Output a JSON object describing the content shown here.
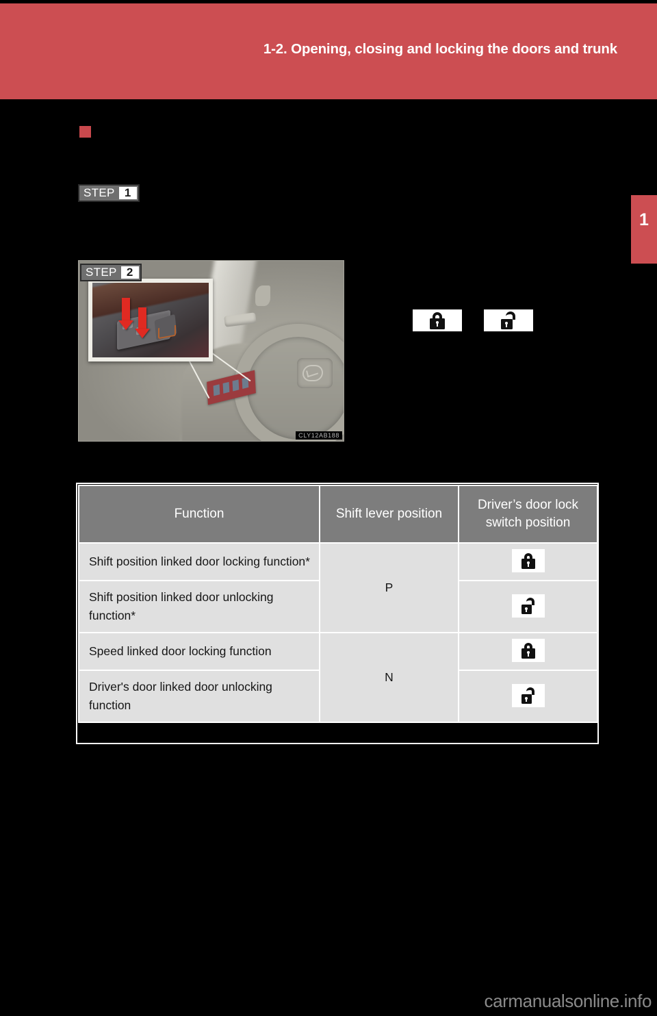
{
  "page": {
    "header_title": "1-2. Opening, closing and locking the doors and trunk",
    "chapter_tab_number": "1",
    "watermark": "carmanualsonline.info",
    "colors": {
      "header_red": "#cc4e52",
      "bullet_red": "#c9494d",
      "table_header_gray": "#7d7d7d",
      "table_cell_gray": "#e0e0e0",
      "page_background": "#000000"
    }
  },
  "section": {
    "bullet_icon": "red-square-bullet",
    "heading": ""
  },
  "steps": [
    {
      "word": "STEP",
      "number": "1",
      "text": ""
    },
    {
      "word": "STEP",
      "number": "2",
      "text": ""
    }
  ],
  "illustration": {
    "caption_code": "CLY12AB188",
    "alt": "Vehicle interior showing driver's door lock switch panel with close-up inset and red press arrows"
  },
  "inline_icons": [
    {
      "name": "lock-icon",
      "state": "locked"
    },
    {
      "name": "unlock-icon",
      "state": "unlocked"
    }
  ],
  "table": {
    "headers": [
      "Function",
      "Shift lever position",
      "Driver’s door lock switch position"
    ],
    "rows": [
      {
        "function": "Shift position linked door locking function*",
        "shift": "P",
        "switch_icon": "locked"
      },
      {
        "function": "Shift position linked door unlocking function*",
        "shift": "P",
        "switch_icon": "unlocked"
      },
      {
        "function": "Speed linked door locking function",
        "shift": "N",
        "switch_icon": "locked"
      },
      {
        "function": "Driver's door linked door unlocking function",
        "shift": "N",
        "switch_icon": "unlocked"
      }
    ],
    "shift_groups": [
      {
        "value": "P",
        "span": 2
      },
      {
        "value": "N",
        "span": 2
      }
    ]
  }
}
